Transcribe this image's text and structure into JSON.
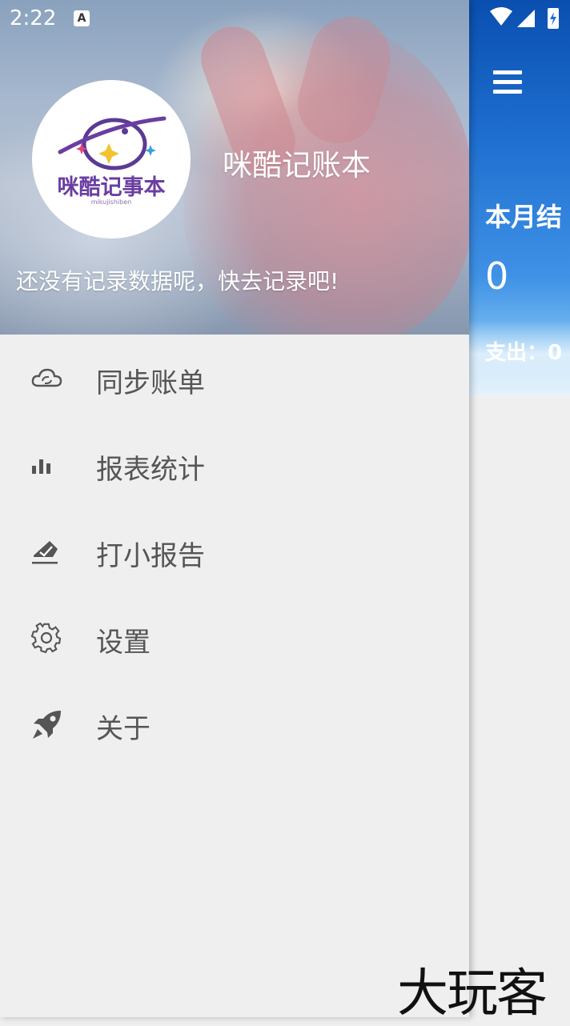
{
  "status_bar": {
    "time": "2:22",
    "notification_icon": "A"
  },
  "main": {
    "month_title": "本月结",
    "month_value": "0",
    "expense_label": "支出：0"
  },
  "drawer": {
    "logo": {
      "title": "咪酷记事本",
      "subtitle": "mikujishiben"
    },
    "app_name": "咪酷记账本",
    "tip": "还没有记录数据呢，快去记录吧!",
    "menu": [
      {
        "label": "同步账单",
        "icon": "cloud-sync-icon"
      },
      {
        "label": "报表统计",
        "icon": "bar-chart-icon"
      },
      {
        "label": "打小报告",
        "icon": "report-icon"
      },
      {
        "label": "设置",
        "icon": "gear-icon"
      },
      {
        "label": "关于",
        "icon": "rocket-icon"
      }
    ]
  },
  "watermark": "大玩客",
  "colors": {
    "header_blue": "#1e6fd0",
    "menu_text": "#555555",
    "icon_gray": "#555555",
    "logo_purple": "#6a3ea1"
  }
}
